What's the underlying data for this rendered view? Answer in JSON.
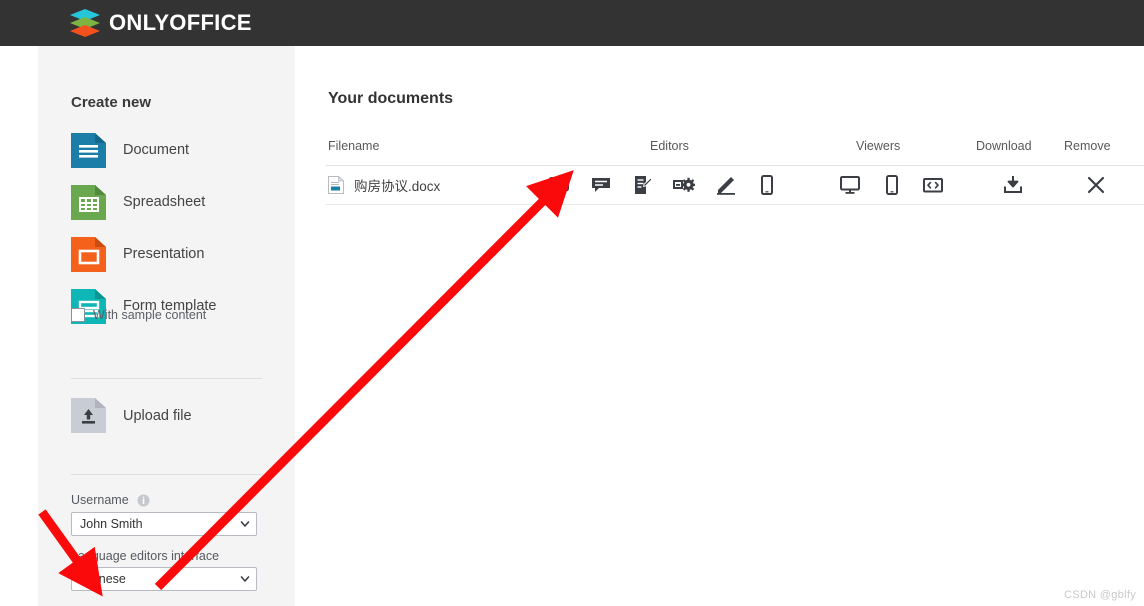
{
  "header": {
    "brand": "ONLYOFFICE",
    "logo_colors": [
      "#26c6da",
      "#7cb342",
      "#f4511e"
    ],
    "background": "#333333"
  },
  "sidebar": {
    "create_new_title": "Create new",
    "create_items": [
      {
        "label": "Document",
        "icon": "document-icon",
        "color": "#1a7ea8"
      },
      {
        "label": "Spreadsheet",
        "icon": "spreadsheet-icon",
        "color": "#6aa84f"
      },
      {
        "label": "Presentation",
        "icon": "presentation-icon",
        "color": "#f4611a"
      },
      {
        "label": "Form template",
        "icon": "form-template-icon",
        "color": "#0fb6b6"
      }
    ],
    "sample_checkbox": {
      "label": "With sample content",
      "checked": false
    },
    "upload": {
      "label": "Upload file",
      "icon": "upload-icon"
    },
    "username_field": {
      "label": "Username",
      "info_icon": "info-icon",
      "value": "John Smith",
      "options": [
        "John Smith"
      ]
    },
    "language_field": {
      "label": "Language editors interface",
      "value": "Chinese",
      "options": [
        "Chinese"
      ]
    }
  },
  "main": {
    "page_title": "Your documents",
    "columns": {
      "filename": "Filename",
      "editors": "Editors",
      "viewers": "Viewers",
      "download": "Download",
      "remove": "Remove"
    },
    "rows": [
      {
        "filename": "购房协议.docx",
        "file_icon": "docx-file-icon",
        "editor_actions": [
          "desktop-editor-icon",
          "comment-editor-icon",
          "review-editor-icon",
          "customization-editor-icon",
          "fill-forms-editor-icon",
          "mobile-editor-icon"
        ],
        "viewer_actions": [
          "desktop-viewer-icon",
          "mobile-viewer-icon",
          "embedded-viewer-icon"
        ],
        "download_action": "download-icon",
        "remove_action": "remove-icon"
      }
    ]
  },
  "watermark": "CSDN @gblfy"
}
